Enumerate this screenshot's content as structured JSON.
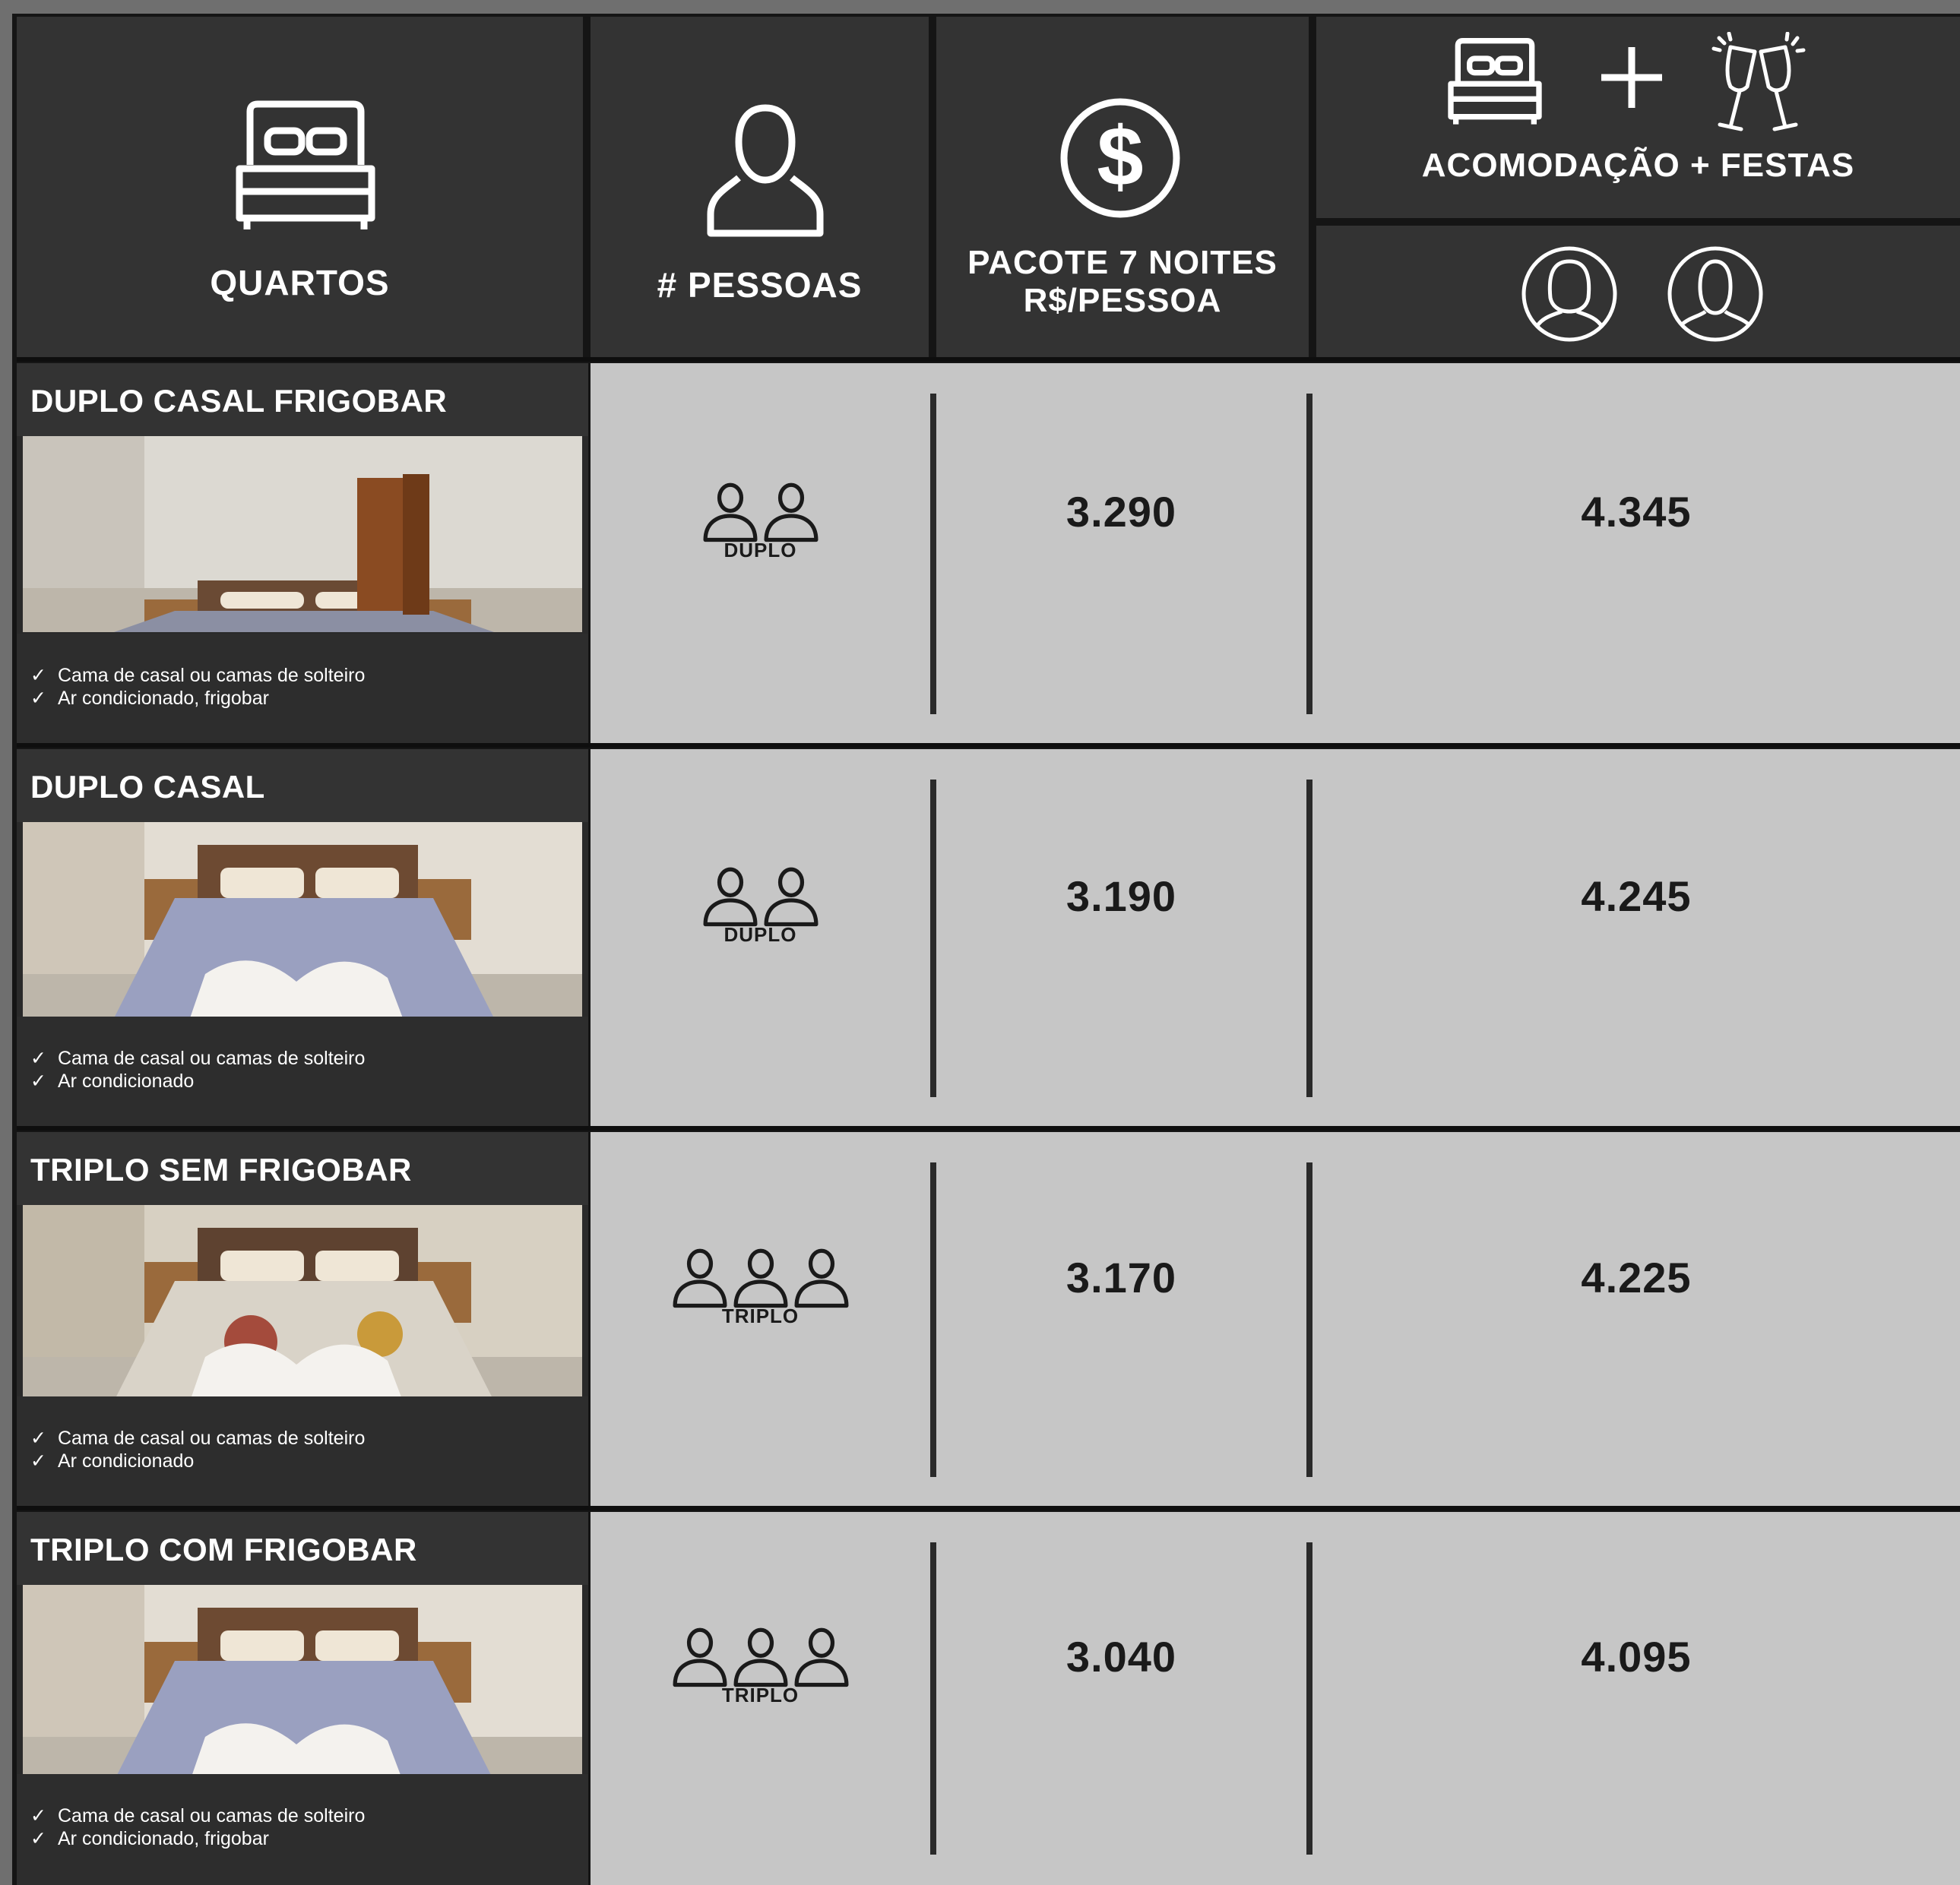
{
  "header": {
    "rooms_label": "QUARTOS",
    "people_label": "# PESSOAS",
    "package_line1": "PACOTE 7 NOITES",
    "package_line2": "R$/PESSOA",
    "combo_label": "ACOMODAÇÃO + FESTAS",
    "icons": [
      "bed-icon",
      "person-icon",
      "dollar-icon",
      "bed-icon",
      "plus-icon",
      "champagne-icon",
      "female-avatar-icon",
      "male-avatar-icon"
    ]
  },
  "rows": [
    {
      "title": "DUPLO CASAL FRIGOBAR",
      "features": [
        "Cama de casal ou camas de solteiro",
        "Ar condicionado, frigobar"
      ],
      "people_type": "DUPLO",
      "price": "3.290",
      "price_combo": "4.345"
    },
    {
      "title": "DUPLO CASAL",
      "features": [
        "Cama de casal ou camas de solteiro",
        "Ar condicionado"
      ],
      "people_type": "DUPLO",
      "price": "3.190",
      "price_combo": "4.245"
    },
    {
      "title": "TRIPLO SEM FRIGOBAR",
      "features": [
        "Cama de casal ou camas de solteiro",
        "Ar condicionado"
      ],
      "people_type": "TRIPLO",
      "price": "3.170",
      "price_combo": "4.225"
    },
    {
      "title": "TRIPLO COM FRIGOBAR",
      "features": [
        "Cama de casal ou camas de solteiro",
        "Ar condicionado, frigobar"
      ],
      "people_type": "TRIPLO",
      "price": "3.040",
      "price_combo": "4.095"
    }
  ],
  "colors": {
    "header_bg": "#333333",
    "row_bg": "#c6c6c6",
    "divider": "#2a2a2a",
    "text_light": "#ffffff",
    "text_dark": "#1a1a1a"
  }
}
